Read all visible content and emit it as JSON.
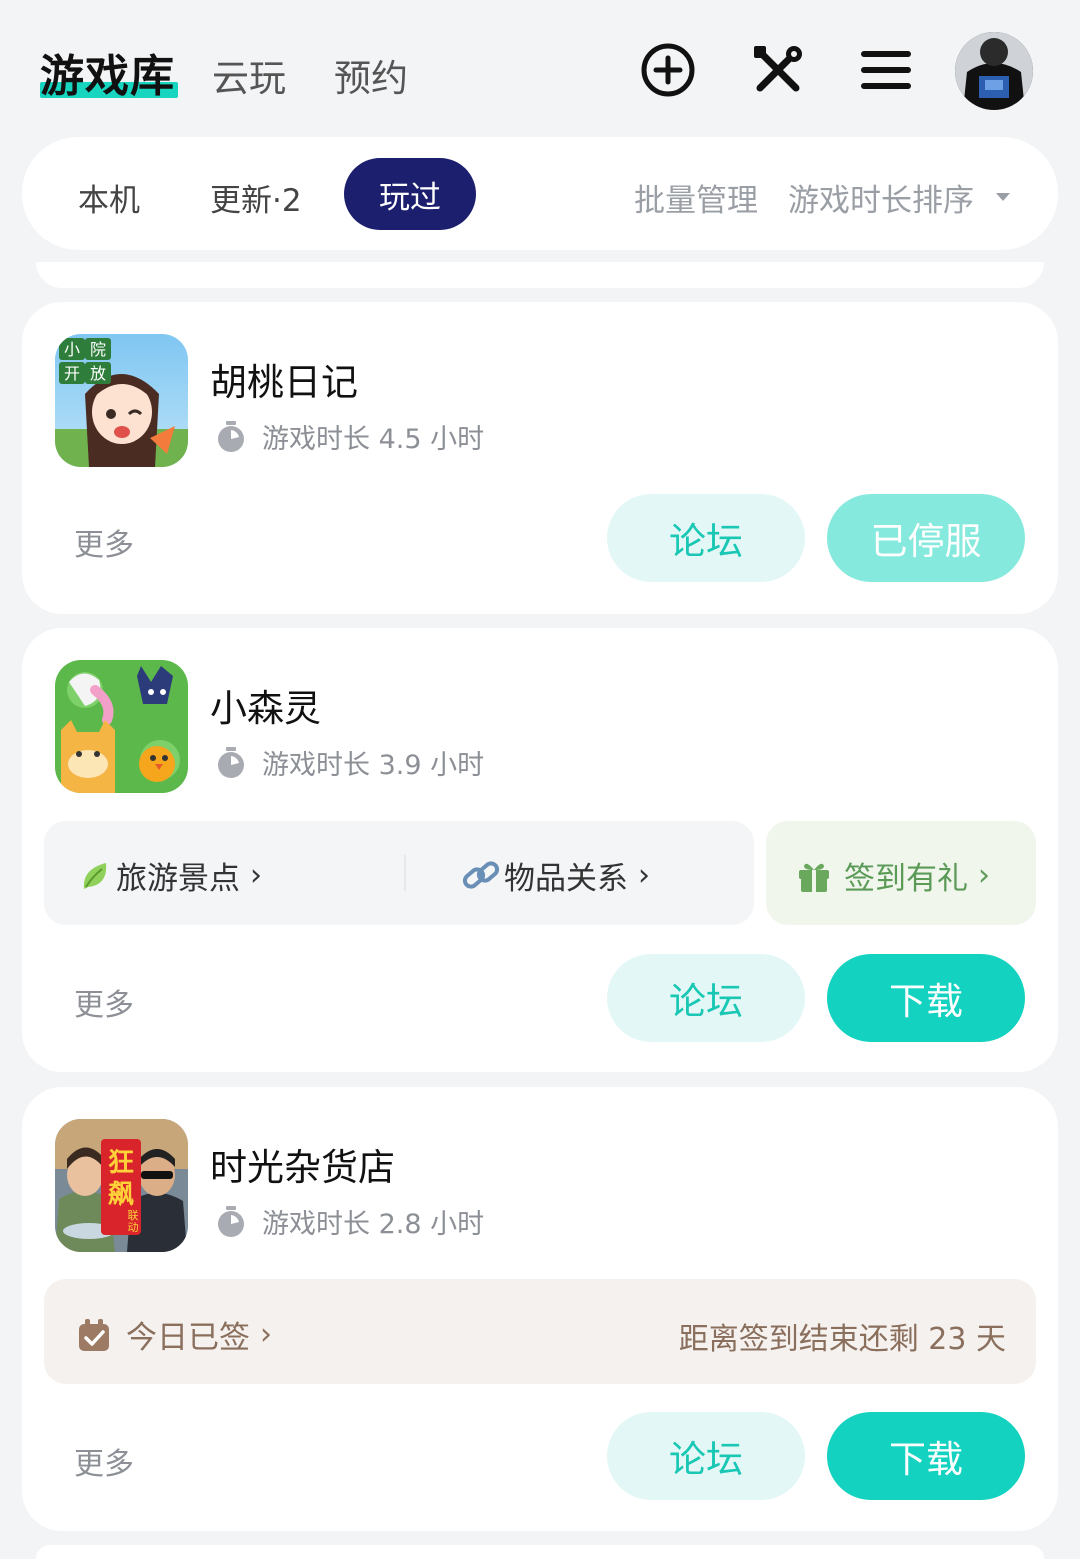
{
  "header": {
    "tabs": [
      {
        "label": "游戏库"
      },
      {
        "label": "云玩"
      },
      {
        "label": "预约"
      }
    ],
    "icons": [
      "add-circle-icon",
      "tools-icon",
      "menu-icon",
      "avatar"
    ]
  },
  "filter": {
    "tabs": [
      {
        "label": "本机"
      },
      {
        "label": "更新·2"
      },
      {
        "label": "玩过"
      }
    ],
    "batch_manage": "批量管理",
    "sort": "游戏时长排序"
  },
  "games": [
    {
      "name": "胡桃日记",
      "playtime": "游戏时长 4.5 小时",
      "icon_text": [
        "小",
        "院",
        "开",
        "放"
      ],
      "more": "更多",
      "forum": "论坛",
      "action": "已停服"
    },
    {
      "name": "小森灵",
      "playtime": "游戏时长 3.9 小时",
      "features": [
        "旅游景点",
        "物品关系"
      ],
      "gift": "签到有礼",
      "more": "更多",
      "forum": "论坛",
      "action": "下载"
    },
    {
      "name": "时光杂货店",
      "playtime": "游戏时长 2.8 小时",
      "icon_text": [
        "狂",
        "飙",
        "联",
        "动"
      ],
      "signed": "今日已签",
      "sign_remaining": "距离签到结束还剩 23 天",
      "more": "更多",
      "forum": "论坛",
      "action": "下载"
    }
  ],
  "colors": {
    "accent": "#13d2bf",
    "active_tab": "#1c1f6e",
    "background": "#f3f4f6"
  }
}
